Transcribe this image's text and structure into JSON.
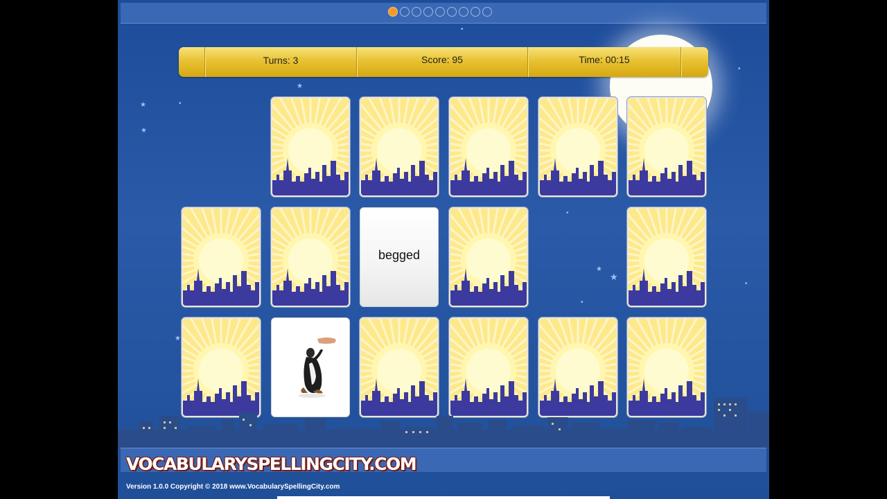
{
  "progress": {
    "total": 9,
    "current": 1
  },
  "scoreboard": {
    "turns": "Turns: 3",
    "score": "Score: 95",
    "time": "Time: 00:15"
  },
  "cards": [
    {
      "row": 0,
      "col": 1,
      "state": "back"
    },
    {
      "row": 0,
      "col": 2,
      "state": "back"
    },
    {
      "row": 0,
      "col": 3,
      "state": "back"
    },
    {
      "row": 0,
      "col": 4,
      "state": "back"
    },
    {
      "row": 0,
      "col": 5,
      "state": "back"
    },
    {
      "row": 1,
      "col": 0,
      "state": "back"
    },
    {
      "row": 1,
      "col": 1,
      "state": "back"
    },
    {
      "row": 1,
      "col": 2,
      "state": "face-word",
      "text": "begged"
    },
    {
      "row": 1,
      "col": 3,
      "state": "back"
    },
    {
      "row": 1,
      "col": 5,
      "state": "back"
    },
    {
      "row": 2,
      "col": 0,
      "state": "back"
    },
    {
      "row": 2,
      "col": 1,
      "state": "face-image",
      "image": "dog-begging-icon"
    },
    {
      "row": 2,
      "col": 2,
      "state": "back"
    },
    {
      "row": 2,
      "col": 3,
      "state": "back"
    },
    {
      "row": 2,
      "col": 4,
      "state": "back"
    },
    {
      "row": 2,
      "col": 5,
      "state": "back"
    }
  ],
  "footer": {
    "logo": "VOCABULARYSPELLINGCITY.COM",
    "version": "Version 1.0.0 Copyright © 2018 www.VocabularySpellingCity.com"
  },
  "colors": {
    "sky": "#1f4f98",
    "scorebar": "#e8c233",
    "card_sun": "#fff7a0",
    "skyline": "#3c3a9e",
    "progress_active": "#f49a2a"
  }
}
